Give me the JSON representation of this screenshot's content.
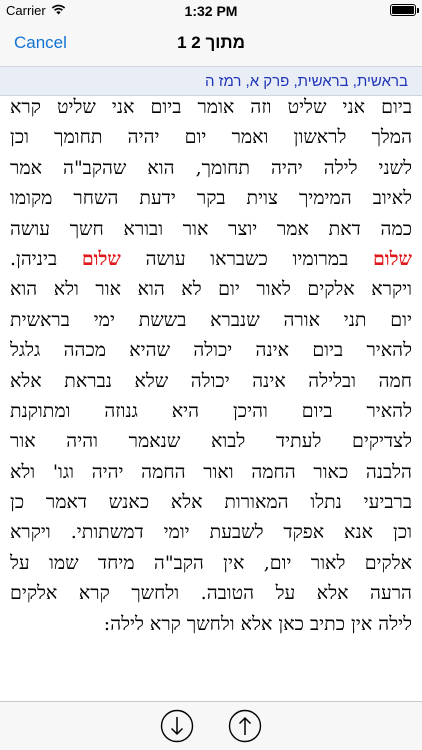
{
  "status_bar": {
    "carrier": "Carrier",
    "time": "1:32 PM",
    "battery_level": 1.0
  },
  "nav_bar": {
    "cancel_label": "Cancel",
    "title": "1 מתוך 2"
  },
  "breadcrumb": {
    "text": "בראשית, בראשית, פרק א, רמז ה"
  },
  "body": {
    "highlight_color": "#e0191c",
    "link_color": "#1273d6",
    "lines": [
      [
        {
          "t": "ביום אני שליט וזה אומר ביום אני שליט קרא"
        }
      ],
      [
        {
          "t": "המלך לראשון ואמר יום יהיה תחומך וכן"
        }
      ],
      [
        {
          "t": "לשני לילה יהיה תחומך, הוא שהקב\"ה אמר"
        }
      ],
      [
        {
          "t": "לאיוב המימיך צוית בקר ידעת השחר מקומו"
        }
      ],
      [
        {
          "t": "כמה דאת אמר יוצר אור ובורא חשך עושה"
        }
      ],
      [
        {
          "t": "שלום",
          "h": true
        },
        {
          "t": " במרומיו כשבראו עושה "
        },
        {
          "t": "שלום",
          "h": true
        },
        {
          "t": " ביניהן."
        }
      ],
      [
        {
          "t": "ויקרא אלקים לאור יום לא הוא אור ולא הוא"
        }
      ],
      [
        {
          "t": "יום תני אורה שנברא בששת ימי בראשית"
        }
      ],
      [
        {
          "t": "להאיר ביום אינה יכולה שהיא מכהה גלגל"
        }
      ],
      [
        {
          "t": "חמה ובלילה אינה יכולה שלא נבראת אלא"
        }
      ],
      [
        {
          "t": "להאיר ביום והיכן היא גנוזה ומתוקנת"
        }
      ],
      [
        {
          "t": "לצדיקים לעתיד לבוא שנאמר והיה אור"
        }
      ],
      [
        {
          "t": "הלבנה כאור החמה ואור החמה יהיה וגו' ולא"
        }
      ],
      [
        {
          "t": "ברביעי נתלו המאורות אלא כאנש דאמר כן"
        }
      ],
      [
        {
          "t": "וכן אנא אפקד לשבעת יומי דמשתותי. ויקרא"
        }
      ],
      [
        {
          "t": "אלקים לאור יום, אין הקב\"ה מיחד שמו על"
        }
      ],
      [
        {
          "t": "הרעה אלא על הטובה. ולחשך קרא אלקים"
        }
      ],
      [
        {
          "t": "לילה אין כתיב כאן אלא ולחשך קרא לילה:"
        }
      ]
    ]
  },
  "toolbar": {
    "next_icon": "arrow-down-circle-icon",
    "prev_icon": "arrow-up-circle-icon"
  }
}
